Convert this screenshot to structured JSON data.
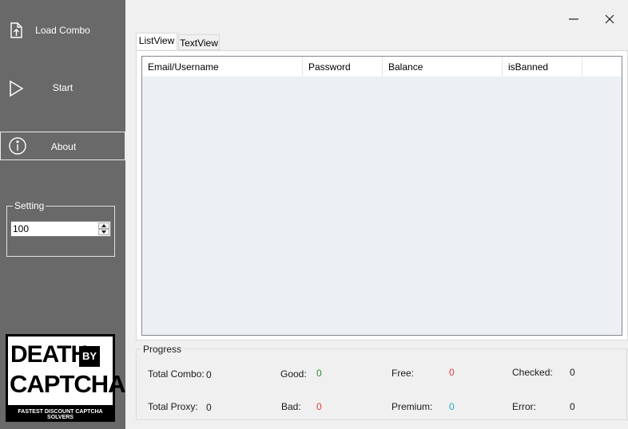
{
  "sidebar": {
    "load_combo": {
      "label": "Load Combo",
      "icon": "upload-file-icon"
    },
    "start": {
      "label": "Start",
      "icon": "play-icon"
    },
    "about": {
      "label": "About",
      "icon": "info-icon"
    },
    "setting": {
      "legend": "Setting",
      "value": "100"
    }
  },
  "logo": {
    "line1": "DEATH",
    "by": "BY",
    "line2": "CAPTCHA",
    "tagline": "FASTEST DISCOUNT CAPTCHA SOLVERS"
  },
  "window": {
    "minimize": "minimize-icon",
    "close": "close-icon"
  },
  "tabs": [
    {
      "label": "ListView",
      "active": true
    },
    {
      "label": "TextView",
      "active": false
    }
  ],
  "listview": {
    "columns": [
      "Email/Username",
      "Password",
      "Balance",
      "isBanned"
    ],
    "rows": []
  },
  "progress": {
    "legend": "Progress",
    "total_combo": {
      "label": "Total Combo:",
      "value": "0"
    },
    "total_proxy": {
      "label": "Total Proxy:",
      "value": "0"
    },
    "good": {
      "label": "Good:",
      "value": "0"
    },
    "bad": {
      "label": "Bad:",
      "value": "0"
    },
    "free": {
      "label": "Free:",
      "value": "0"
    },
    "premium": {
      "label": "Premium:",
      "value": "0"
    },
    "checked": {
      "label": "Checked:",
      "value": "0"
    },
    "error": {
      "label": "Error:",
      "value": "0"
    }
  },
  "colors": {
    "sidebar_bg": "#696969",
    "good": "#2e8b2e",
    "bad": "#e03c3c",
    "free": "#e03c3c",
    "premium": "#2aa9c4"
  }
}
